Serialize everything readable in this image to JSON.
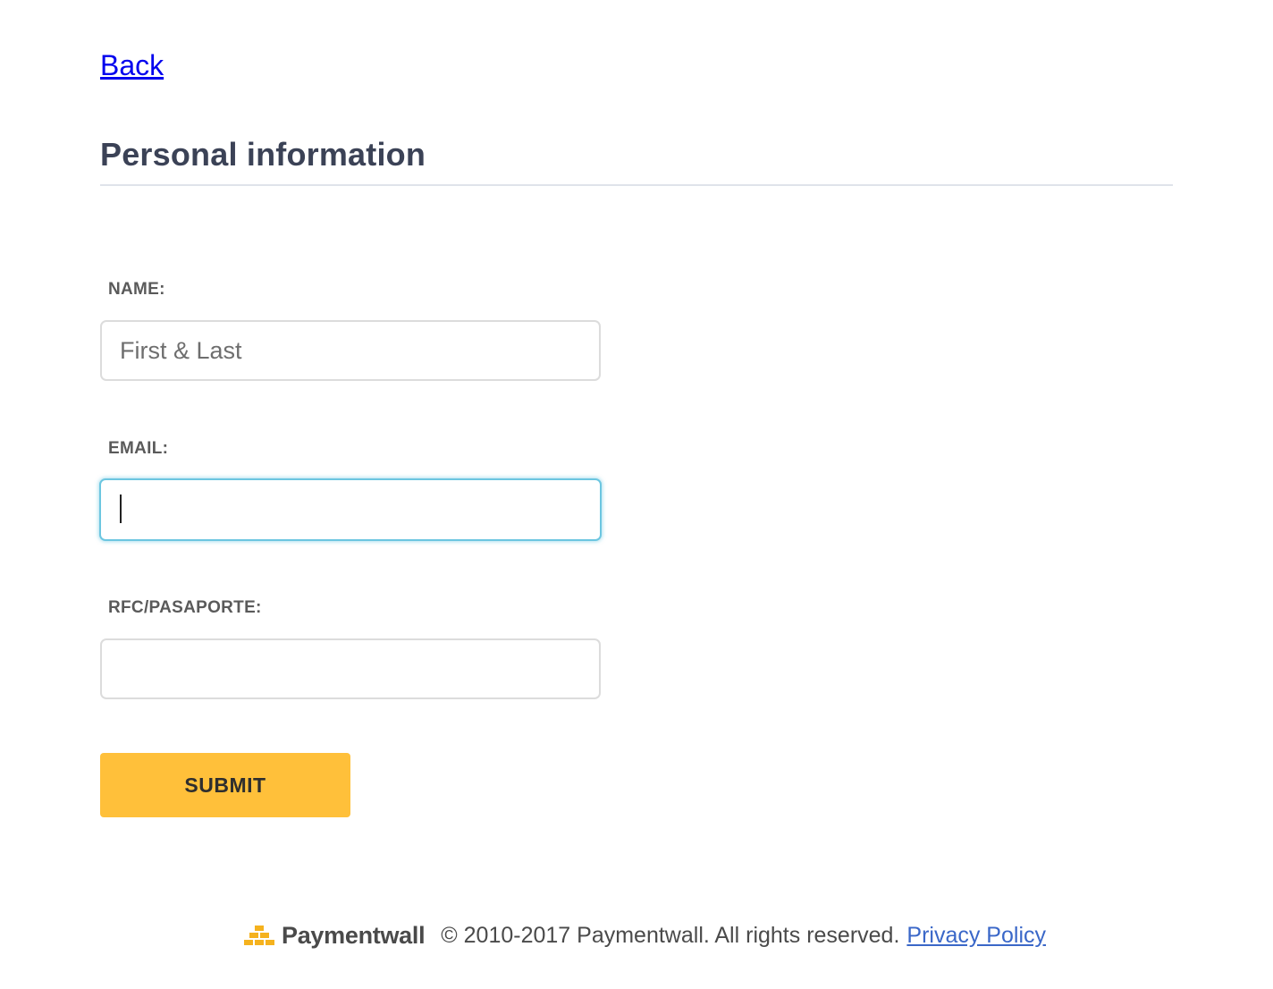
{
  "nav": {
    "back_label": "Back"
  },
  "page": {
    "title": "Personal information"
  },
  "form": {
    "name": {
      "label": "NAME:",
      "value": "",
      "placeholder": "First & Last"
    },
    "email": {
      "label": "EMAIL:",
      "value": "",
      "placeholder": "",
      "focused": true
    },
    "rfc": {
      "label": "RFC/PASAPORTE:",
      "value": "",
      "placeholder": ""
    },
    "submit_label": "SUBMIT"
  },
  "footer": {
    "brand_name": "Paymentwall",
    "brand_icon": "paymentwall-bricks-icon",
    "copyright": "© 2010-2017 Paymentwall. All rights reserved.",
    "privacy_label": "Privacy Policy"
  },
  "colors": {
    "accent_button": "#ffc03a",
    "focus_border": "#6cc6e0",
    "title_text": "#3b4256",
    "link": "#0000ee",
    "footer_link": "#3a67c8"
  }
}
